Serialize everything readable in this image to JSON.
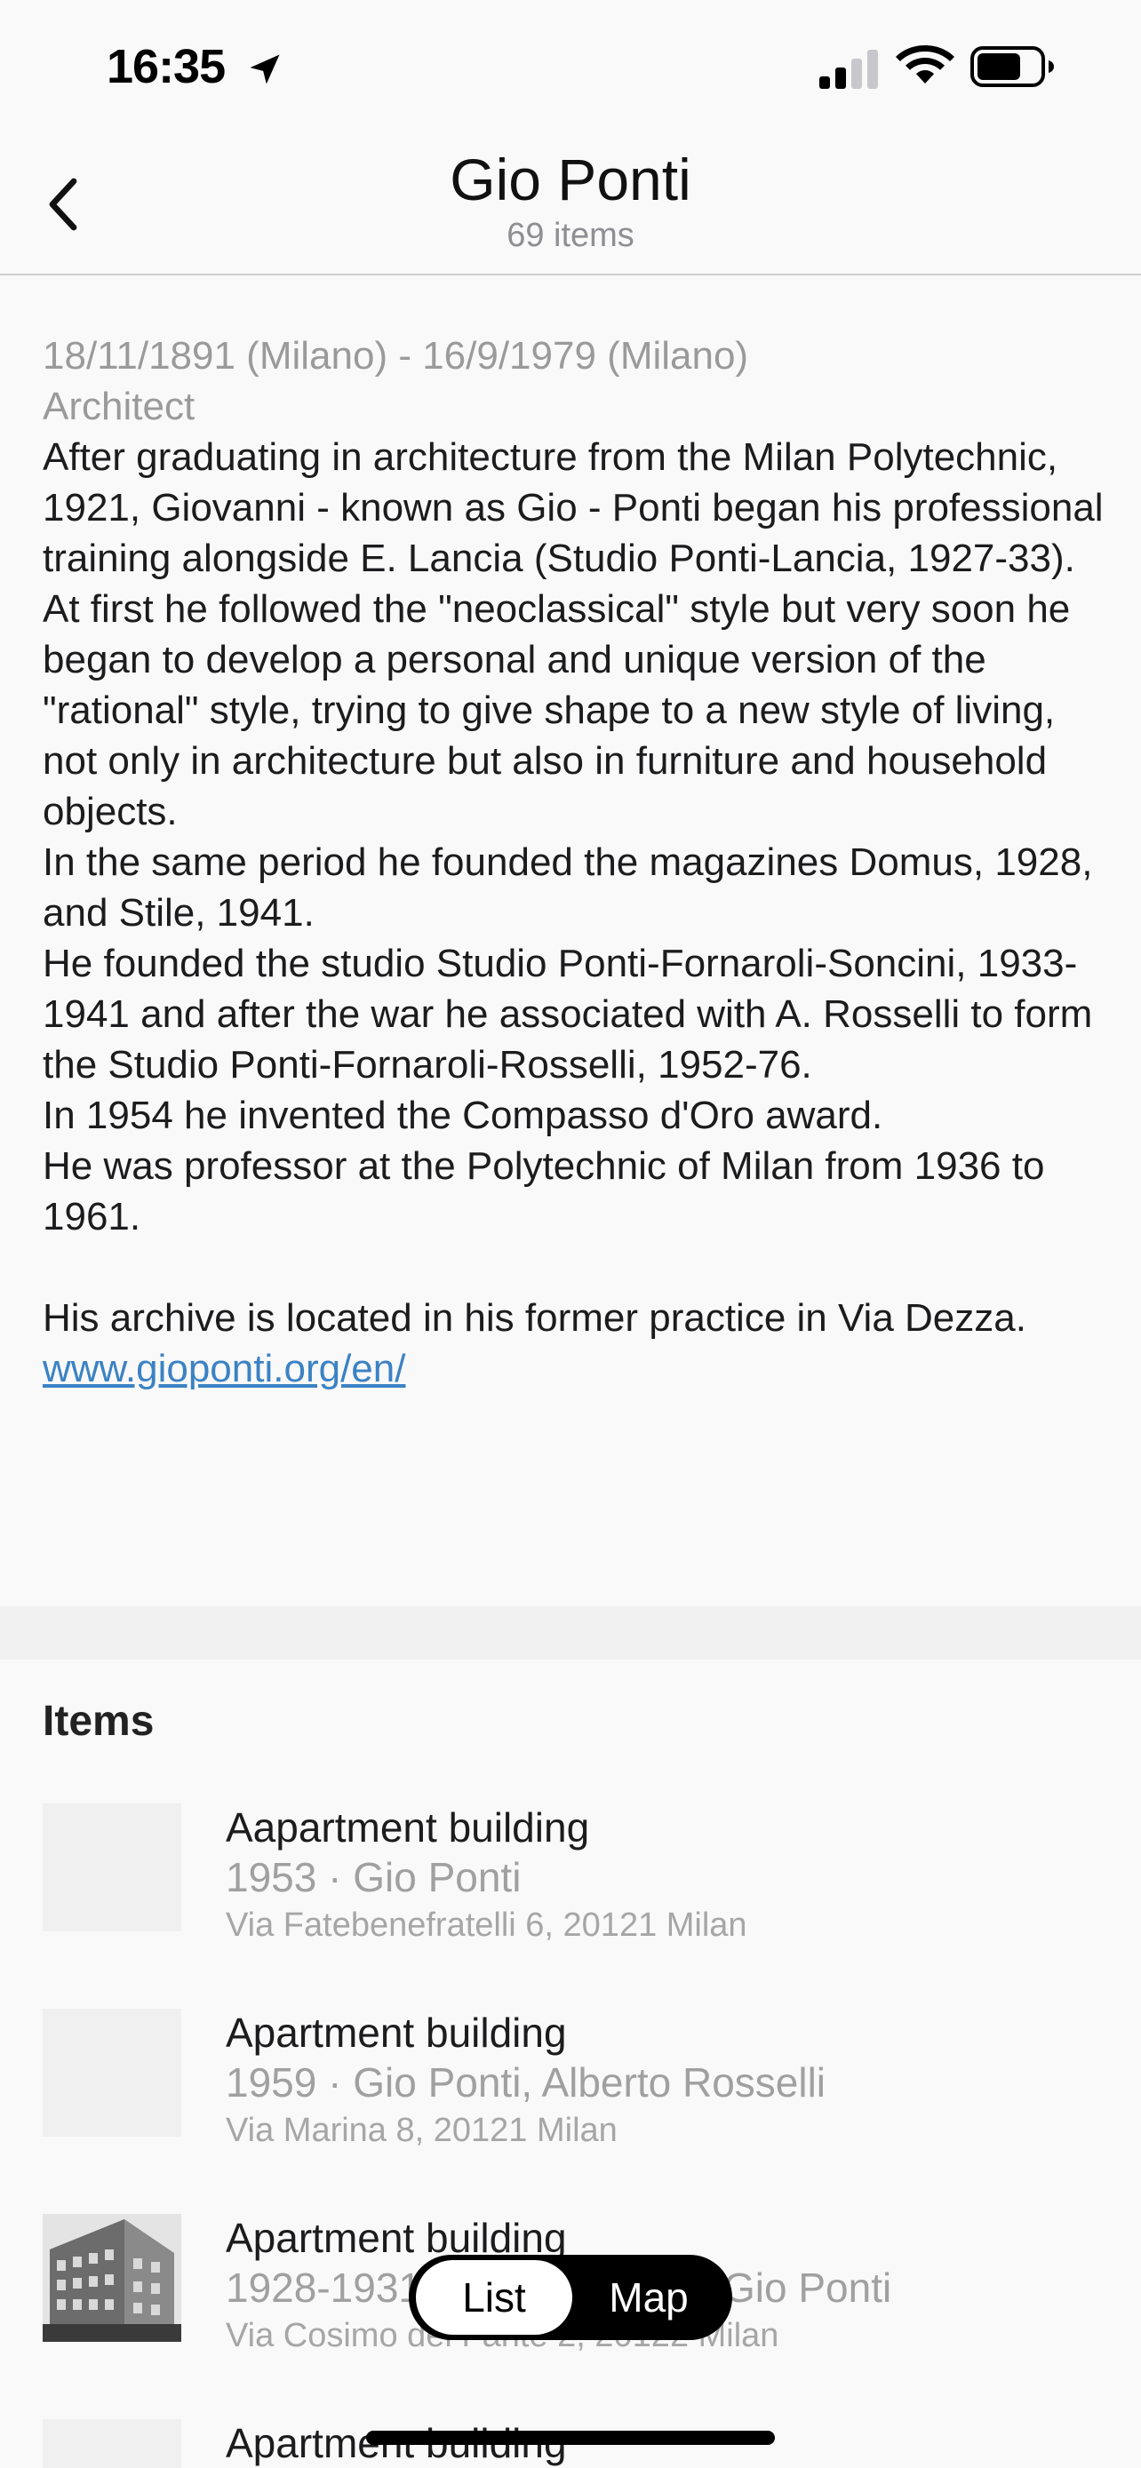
{
  "status_bar": {
    "time": "16:35"
  },
  "nav": {
    "title": "Gio Ponti",
    "subtitle": "69 items"
  },
  "bio": {
    "dates": "18/11/1891 (Milano) - 16/9/1979 (Milano)",
    "role": "Architect",
    "text": "After graduating in architecture from the Milan Polytechnic, 1921, Giovanni - known as Gio - Ponti began his professional training alongside E. Lancia (Studio Ponti-Lancia, 1927-33).\nAt first he followed the \"neoclassical\" style but very soon he began to develop a personal and unique version of the \"rational\" style, trying to give shape to a new style of living, not only in architecture but also in furniture and household objects.\nIn the same period he founded the magazines Domus, 1928, and Stile, 1941.\nHe founded the studio Studio Ponti-Fornaroli-Soncini, 1933-1941 and after the war he associated with A. Rosselli to form the Studio Ponti-Fornaroli-Rosselli, 1952-76.\nIn 1954 he invented the Compasso d'Oro award.\nHe was professor at the Polytechnic of Milan from 1936 to 1961.\n\nHis archive is located in his former practice in Via Dezza.",
    "link": "www.gioponti.org/en/"
  },
  "items": {
    "header": "Items",
    "list": [
      {
        "title": "Aapartment building",
        "subtitle": "1953 · Gio Ponti",
        "address": "Via Fatebenefratelli 6, 20121 Milan"
      },
      {
        "title": "Apartment building",
        "subtitle": "1959 · Gio Ponti, Alberto Rosselli",
        "address": "Via Marina 8, 20121 Milan"
      },
      {
        "title": "Apartment building",
        "subtitle": "1928-1931 · Emilio Lancia, Gio Ponti",
        "address": "Via Cosimo del Fante 2, 20122 Milan"
      },
      {
        "title": "Apartment building"
      }
    ]
  },
  "view_toggle": {
    "list_label": "List",
    "map_label": "Map",
    "selected": "List"
  },
  "colors": {
    "link": "#3b82c4",
    "toggle_bg": "#000000"
  }
}
